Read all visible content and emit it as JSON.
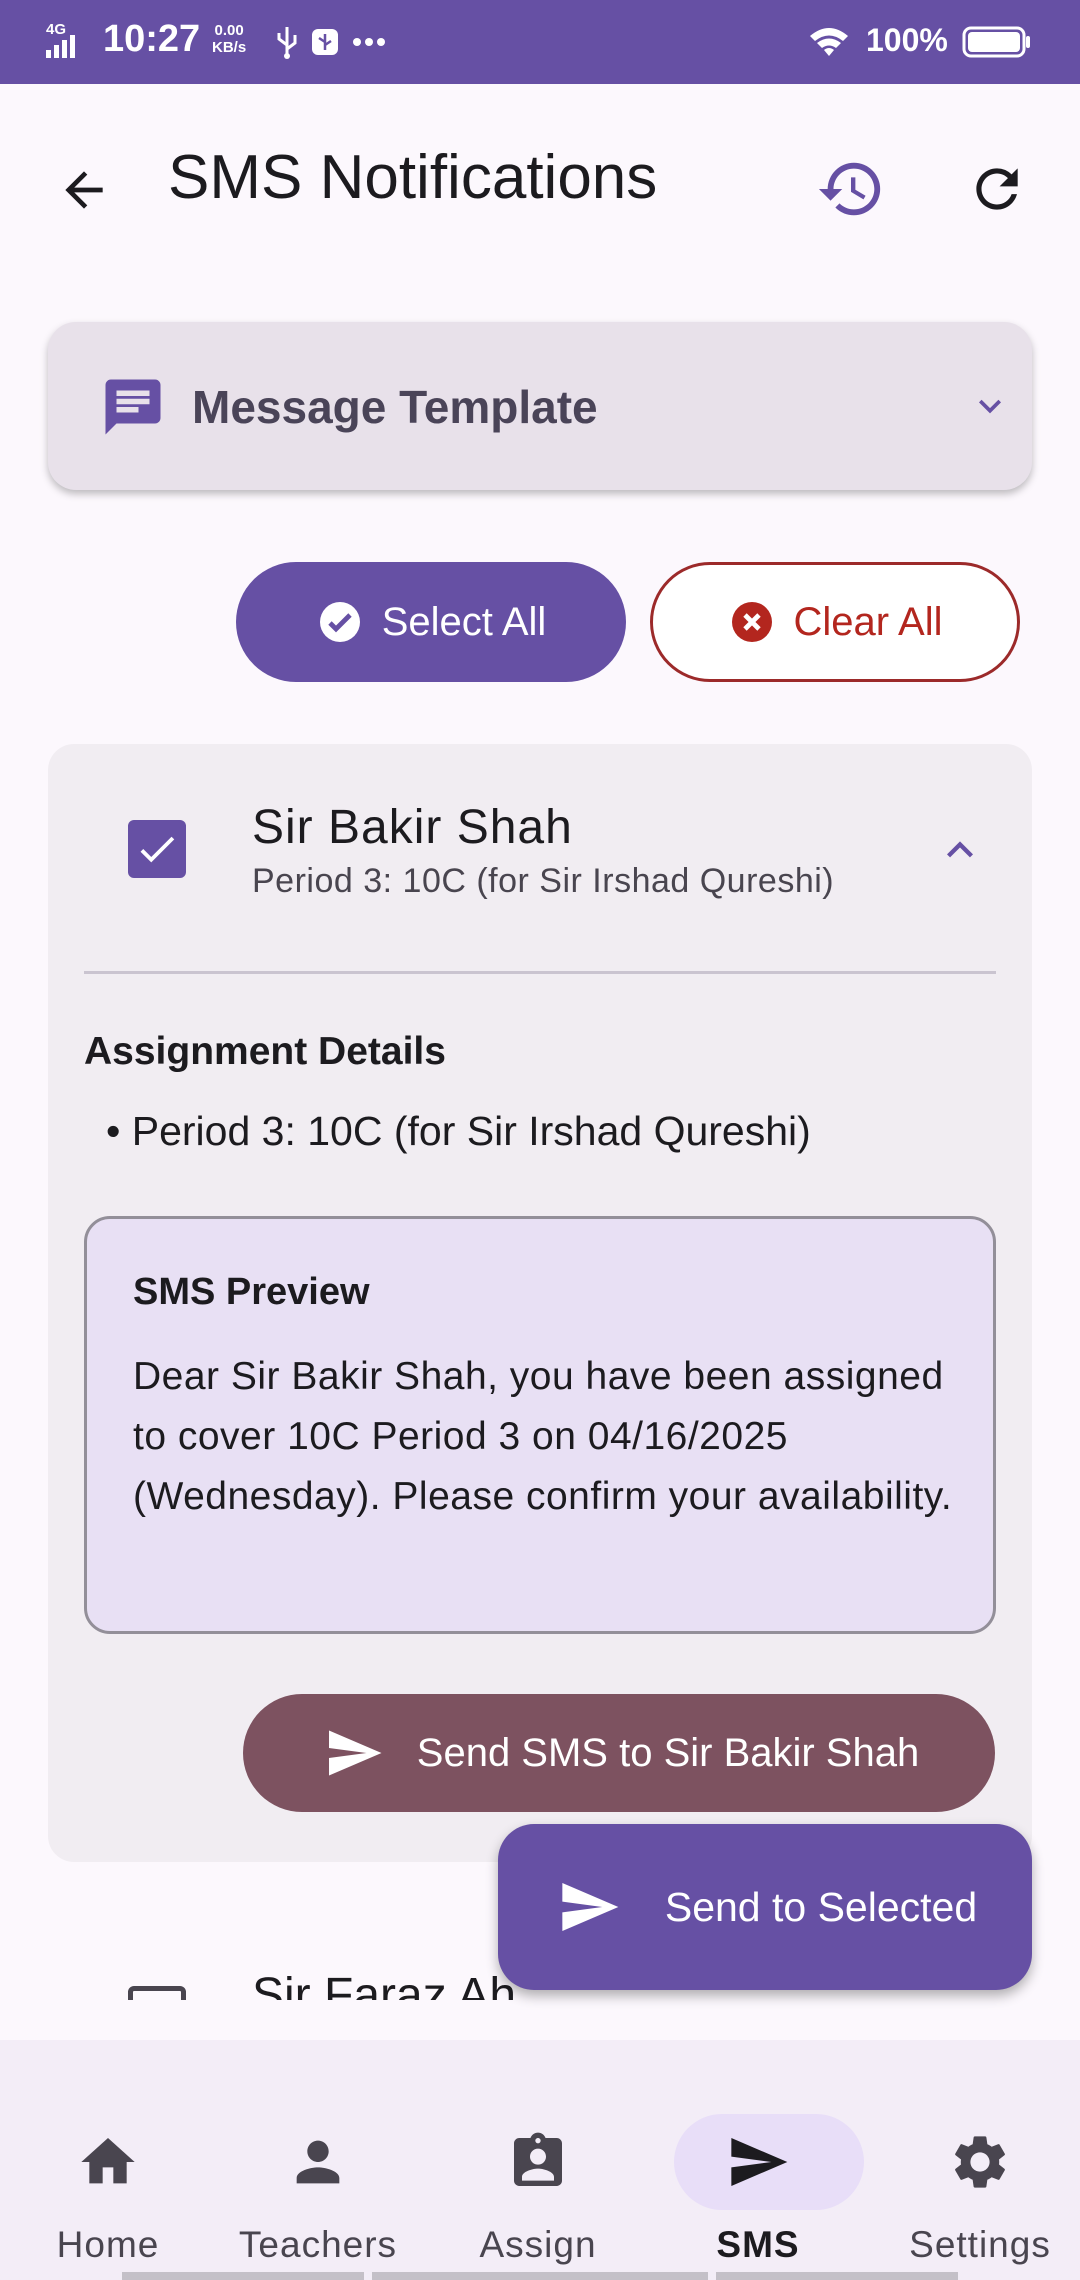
{
  "status_bar": {
    "network": "4G",
    "time": "10:27",
    "speed_value": "0.00",
    "speed_unit": "KB/s",
    "battery": "100%"
  },
  "app_bar": {
    "title": "SMS Notifications",
    "icons": [
      "arrow-back-icon",
      "history-icon",
      "refresh-icon"
    ]
  },
  "template_section": {
    "title": "Message Template",
    "icon": "message-icon",
    "expanded": false
  },
  "actions": {
    "select_all": "Select All",
    "clear_all": "Clear All"
  },
  "teacher_card": {
    "name": "Sir Bakir Shah",
    "subtitle": "Period 3: 10C (for Sir Irshad Qureshi)",
    "checked": true,
    "assignment_title": "Assignment Details",
    "assignment_item": "Period 3: 10C (for Sir Irshad Qureshi)",
    "preview_title": "SMS Preview",
    "preview_text": "Dear Sir Bakir Shah, you have been assigned to cover 10C Period 3 on 04/16/2025 (Wednesday). Please confirm your availability.",
    "send_button": "Send SMS to Sir Bakir Shah"
  },
  "next_teacher": {
    "name": "Sir Faraz Ah"
  },
  "fab": {
    "label": "Send to Selected"
  },
  "bottom_nav": {
    "items": [
      {
        "label": "Home",
        "icon": "home-icon",
        "active": false
      },
      {
        "label": "Teachers",
        "icon": "person-icon",
        "active": false
      },
      {
        "label": "Assign",
        "icon": "assignment-icon",
        "active": false
      },
      {
        "label": "SMS",
        "icon": "send-icon",
        "active": true
      },
      {
        "label": "Settings",
        "icon": "settings-icon",
        "active": false
      }
    ]
  },
  "colors": {
    "primary": "#6650a4",
    "error": "#b3261e",
    "send_single": "#7d5260",
    "preview_bg": "#e8e0f4"
  }
}
